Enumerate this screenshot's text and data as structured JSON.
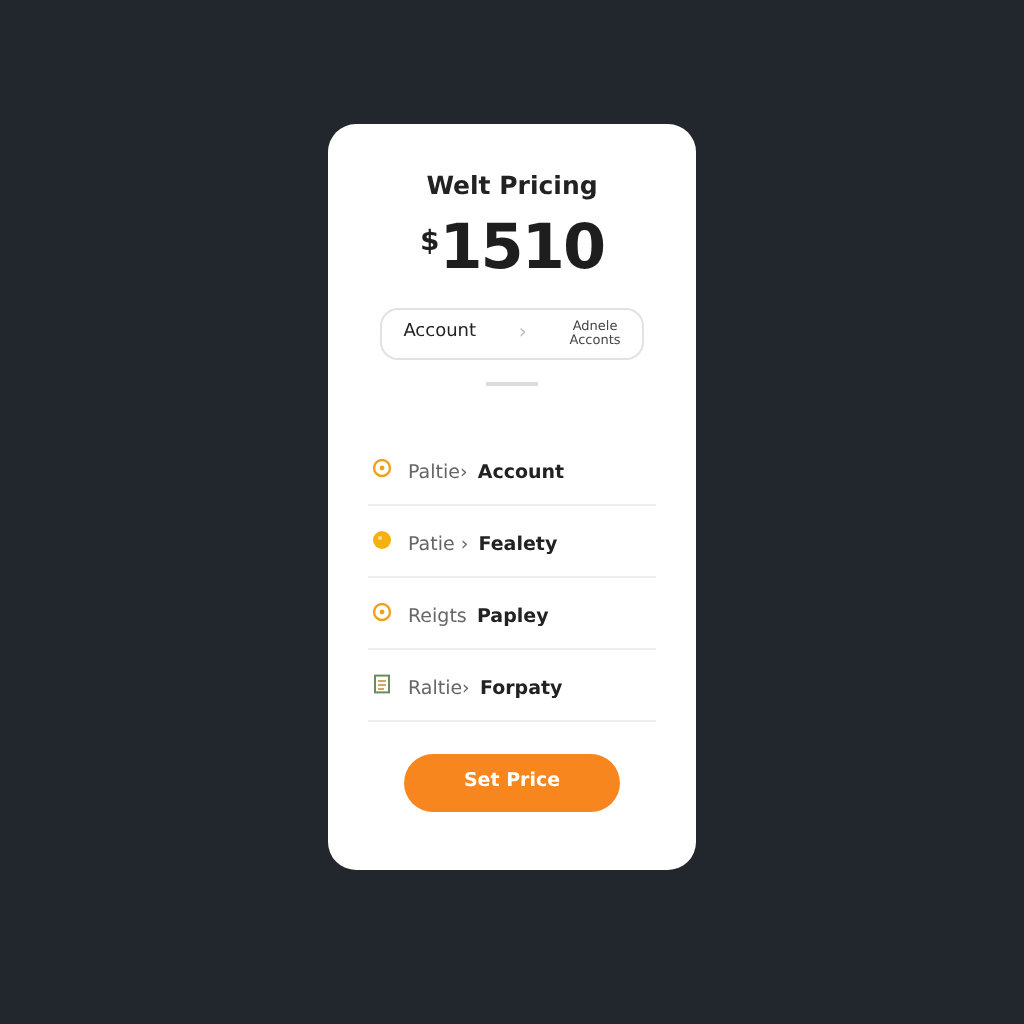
{
  "card": {
    "title": "Welt Pricing",
    "price": {
      "currency": "$",
      "amount": "1510"
    },
    "segment": {
      "left": "Account",
      "separator": "›",
      "right_lines": [
        "Adnele",
        "Acconts"
      ]
    },
    "items": [
      {
        "kind": "ring",
        "prefix": "Paltie›",
        "label": "Account"
      },
      {
        "kind": "dot",
        "prefix": "Patie ›",
        "label": "Fealety"
      },
      {
        "kind": "ring",
        "prefix": "Reigts",
        "label": "Papley"
      },
      {
        "kind": "doc",
        "prefix": "Raltie›",
        "label": "Forpaty"
      }
    ],
    "button": "Set Price"
  }
}
